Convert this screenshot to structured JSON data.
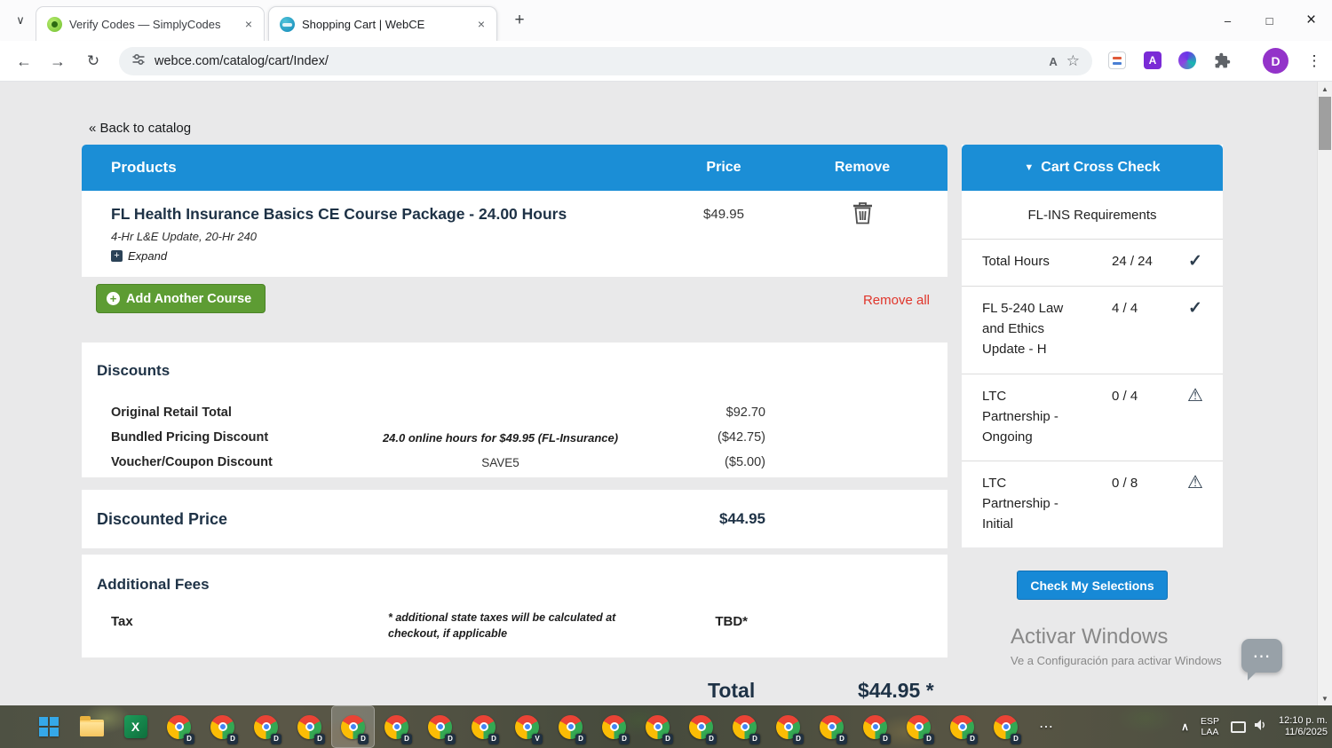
{
  "browser": {
    "tabs": [
      {
        "title": "Verify Codes — SimplyCodes"
      },
      {
        "title": "Shopping Cart | WebCE"
      }
    ],
    "url": "webce.com/catalog/cart/Index/",
    "profile_initial": "D",
    "icons": {
      "tab_search": "∨",
      "tab_close": "×",
      "new_tab": "+",
      "minimize": "–",
      "maximize": "□",
      "close": "×",
      "back": "←",
      "forward": "→",
      "reload": "↻",
      "translate": "A",
      "bookmark": "☆",
      "extension_a": "A",
      "menu": "⋮"
    }
  },
  "page": {
    "back_link": "« Back to catalog",
    "cart": {
      "header": {
        "products": "Products",
        "price": "Price",
        "remove": "Remove"
      },
      "item": {
        "title": "FL Health Insurance Basics CE Course Package - 24.00 Hours",
        "subtitle": "4-Hr L&E Update, 20-Hr 240",
        "expand_icon": "+",
        "expand_label": "Expand",
        "price": "$49.95"
      },
      "add_course_label": "Add Another Course",
      "remove_all_label": "Remove all"
    },
    "discounts": {
      "heading": "Discounts",
      "rows": [
        {
          "label": "Original Retail Total",
          "note": "",
          "value": "$92.70"
        },
        {
          "label": "Bundled Pricing Discount",
          "note": "24.0 online hours for $49.95 (FL-Insurance)",
          "value": "($42.75)"
        },
        {
          "label": "Voucher/Coupon Discount",
          "note": "SAVE5",
          "value": "($5.00)"
        }
      ],
      "discounted_price_label": "Discounted Price",
      "discounted_price_value": "$44.95"
    },
    "fees": {
      "heading": "Additional Fees",
      "tax_label": "Tax",
      "tax_note": "* additional state taxes will be calculated at checkout, if applicable",
      "tax_value": "TBD*"
    },
    "total": {
      "label": "Total",
      "value": "$44.95 *"
    }
  },
  "cross_check": {
    "collapse_icon": "▼",
    "title": "Cart Cross Check",
    "subtitle": "FL-INS Requirements",
    "items": [
      {
        "label": "Total Hours",
        "value": "24 / 24",
        "icon": "✓",
        "status": "ok"
      },
      {
        "label": "FL 5-240 Law and Ethics Update - H",
        "value": "4 / 4",
        "icon": "✓",
        "status": "ok"
      },
      {
        "label": "LTC Partnership - Ongoing",
        "value": "0 / 4",
        "icon": "⚠",
        "status": "warning"
      },
      {
        "label": "LTC Partnership - Initial",
        "value": "0 / 8",
        "icon": "⚠",
        "status": "warning"
      }
    ],
    "button_label": "Check My Selections"
  },
  "watermark": {
    "title": "Activar Windows",
    "subtitle": "Ve a Configuración para activar Windows"
  },
  "feedback_icon": "⋯",
  "scrollbar": {
    "up": "▲",
    "down": "▼"
  },
  "taskbar": {
    "excel_letter": "X",
    "overflow": "⋯",
    "tray_expand": "∧",
    "language_line1": "ESP",
    "language_line2": "LAA",
    "time": "12:10 p. m.",
    "date": "11/6/2025",
    "app_badges": [
      "D",
      "D",
      "D",
      "D",
      "D",
      "D",
      "D",
      "D",
      "V",
      "D",
      "D",
      "D",
      "D",
      "D",
      "D",
      "D",
      "D",
      "D",
      "D",
      "D"
    ],
    "active_app_index": 4
  },
  "colors": {
    "header_blue": "#1b8ed6",
    "button_green": "#5d9c33",
    "danger_red": "#e0352b",
    "title_navy": "#1e3246"
  }
}
